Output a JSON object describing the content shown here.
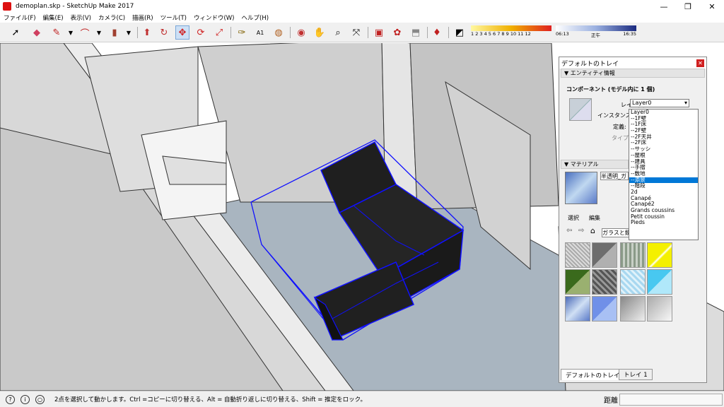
{
  "window": {
    "title": "demoplan.skp - SketchUp Make 2017",
    "minimize": "—",
    "maximize": "❐",
    "close": "✕"
  },
  "menu": [
    "ファイル(F)",
    "編集(E)",
    "表示(V)",
    "カメラ(C)",
    "描画(R)",
    "ツール(T)",
    "ウィンドウ(W)",
    "ヘルプ(H)"
  ],
  "toolbar": {
    "tools": [
      "select-arrow",
      "eraser",
      "pencil-line",
      "arc",
      "rectangle",
      "push-pull",
      "follow-me",
      "move",
      "rotate",
      "scale",
      "tape-measure",
      "text-label",
      "paint-bucket",
      "orbit",
      "pan",
      "zoom",
      "zoom-extents",
      "warehouse",
      "extensions",
      "share",
      "ruby"
    ],
    "active_tool": "move",
    "shadow_months": "1 2 3 4 5 6 7 8 9 10 11 12",
    "shadow_time_start": "06:13",
    "shadow_time_mid": "正午",
    "shadow_time_end": "16:35"
  },
  "tray": {
    "title": "デフォルトのトレイ",
    "entity_section": "エンティティ情報",
    "component_heading": "コンポーネント (モデル内に 1 個)",
    "layer_label": "レイヤ(L):",
    "layer_value": "Layer0",
    "instance_label": "インスタンス:",
    "definition_label": "定義:",
    "type_label": "タイプ:",
    "material_section": "マテリアル",
    "material_name": "半透明_ガ",
    "select_tab": "選択",
    "edit_tab": "編集",
    "library_name": "ガラスと鏡",
    "bottom_tabs": [
      "デフォルトのトレイ",
      "トレイ 1"
    ]
  },
  "layer_dropdown": {
    "options": [
      "Layer0",
      "--1F壁",
      "--1F床",
      "--2F壁",
      "--2F天井",
      "--2F床",
      "--サッシ",
      "--屋根",
      "--建具",
      "--手摺",
      "--敷地",
      "--添景",
      "--階段",
      "2d",
      "Canapé",
      "Canapé2",
      "Grands coussins",
      "Petit coussin",
      "Pieds"
    ],
    "selected_index": 11
  },
  "swatches": [
    "#b8b8b8",
    "#8c8c8c",
    "#aab4a8",
    "#f4f000",
    "#3a6a1c",
    "#6d6d6d",
    "#a8d8f0",
    "#48c8f0",
    "#6a8cc8",
    "#7090e8",
    "#c8c8c8",
    "#e8e8e8"
  ],
  "status": {
    "message": "2点を選択して動かします。Ctrl =コピーに切り替える、Alt = 自動折り返しに切り替える、Shift = 推定をロック。",
    "measure_label": "距離",
    "measure_value": ""
  },
  "colors": {
    "selection_blue": "#1010ff",
    "floor": "#a9b5c0",
    "wall": "#d6d6d6"
  }
}
